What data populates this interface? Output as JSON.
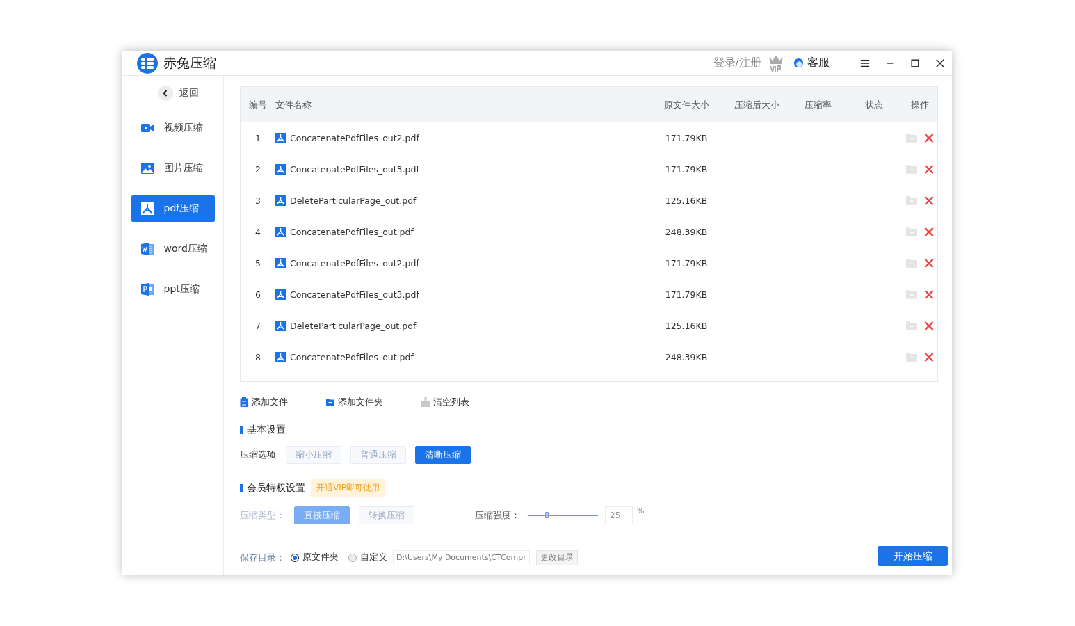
{
  "window": {
    "title": "赤兔压缩",
    "login": "登录/注册",
    "service": "客服"
  },
  "sidebar": {
    "back": "返回",
    "items": [
      {
        "kind": "video",
        "label": "视频压缩",
        "selected": false
      },
      {
        "kind": "image",
        "label": "图片压缩",
        "selected": false
      },
      {
        "kind": "pdf",
        "label": "pdf压缩",
        "selected": true
      },
      {
        "kind": "word",
        "label": "word压缩",
        "selected": false
      },
      {
        "kind": "ppt",
        "label": "ppt压缩",
        "selected": false
      }
    ]
  },
  "table": {
    "columns": [
      "编号",
      "文件名称",
      "原文件大小",
      "压缩后大小",
      "压缩率",
      "状态",
      "操作"
    ],
    "rows": [
      {
        "no": "1",
        "name": "ConcatenatePdfFiles_out2.pdf",
        "size": "171.79KB"
      },
      {
        "no": "2",
        "name": "ConcatenatePdfFiles_out3.pdf",
        "size": "171.79KB"
      },
      {
        "no": "3",
        "name": "DeleteParticularPage_out.pdf",
        "size": "125.16KB"
      },
      {
        "no": "4",
        "name": "ConcatenatePdfFiles_out.pdf",
        "size": "248.39KB"
      },
      {
        "no": "5",
        "name": "ConcatenatePdfFiles_out2.pdf",
        "size": "171.79KB"
      },
      {
        "no": "6",
        "name": "ConcatenatePdfFiles_out3.pdf",
        "size": "171.79KB"
      },
      {
        "no": "7",
        "name": "DeleteParticularPage_out.pdf",
        "size": "125.16KB"
      },
      {
        "no": "8",
        "name": "ConcatenatePdfFiles_out.pdf",
        "size": "248.39KB"
      }
    ]
  },
  "toolbar": [
    {
      "kind": "file",
      "label": "添加文件"
    },
    {
      "kind": "folder",
      "label": "添加文件夹"
    },
    {
      "kind": "clear",
      "label": "清空列表"
    }
  ],
  "basic": {
    "title": "基本设置",
    "label": "压缩选项",
    "options": [
      {
        "label": "缩小压缩",
        "selected": false
      },
      {
        "label": "普通压缩",
        "selected": false
      },
      {
        "label": "清晰压缩",
        "selected": true
      }
    ]
  },
  "vip": {
    "title": "会员特权设置",
    "tag": "开通VIP即可使用",
    "type_label": "压缩类型：",
    "disabled": true,
    "types": [
      {
        "label": "直接压缩",
        "selected": true
      },
      {
        "label": "转换压缩",
        "selected": false
      }
    ],
    "strength_label": "压缩强度：",
    "level": 0.27,
    "value": "25",
    "unit": "%"
  },
  "save": {
    "label": "保存目录：",
    "options": [
      {
        "label": "原文件夹",
        "selected": true
      },
      {
        "label": "自定义",
        "selected": false
      }
    ],
    "path": "D:\\Users\\My Documents\\CTCompr",
    "change": "更改目录"
  },
  "start": "开始压缩"
}
